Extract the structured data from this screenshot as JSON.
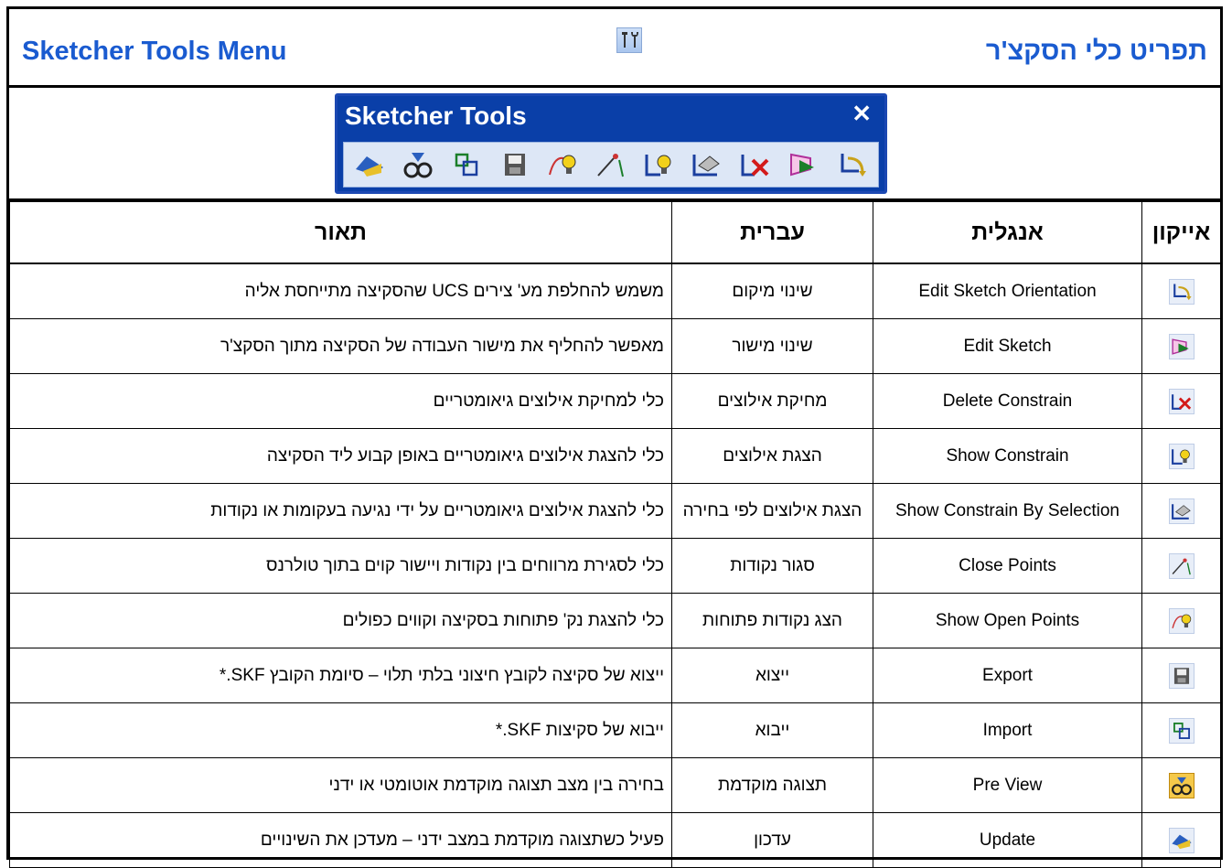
{
  "header": {
    "title_en": "Sketcher Tools Menu",
    "title_he": "תפריט כלי הסקצ'ר"
  },
  "toolbar": {
    "title": "Sketcher Tools",
    "close": "✕"
  },
  "table": {
    "columns": {
      "icon": "אייקון",
      "english": "אנגלית",
      "hebrew": "עברית",
      "description": "תאור"
    },
    "rows": [
      {
        "icon": "edit-sketch-orientation-icon",
        "english": "Edit Sketch Orientation",
        "hebrew": "שינוי מיקום",
        "description": "משמש להחלפת מע' צירים UCS שהסקיצה מתייחסת אליה"
      },
      {
        "icon": "edit-sketch-icon",
        "english": "Edit Sketch",
        "hebrew": "שינוי מישור",
        "description": "מאפשר להחליף את מישור העבודה של הסקיצה מתוך הסקצ'ר"
      },
      {
        "icon": "delete-constrain-icon",
        "english": "Delete Constrain",
        "hebrew": "מחיקת אילוצים",
        "description": "כלי למחיקת אילוצים גיאומטריים"
      },
      {
        "icon": "show-constrain-icon",
        "english": "Show Constrain",
        "hebrew": "הצגת אילוצים",
        "description": "כלי להצגת אילוצים גיאומטריים באופן קבוע ליד הסקיצה"
      },
      {
        "icon": "show-constrain-by-selection-icon",
        "english": "Show Constrain By Selection",
        "hebrew": "הצגת אילוצים לפי בחירה",
        "description": "כלי להצגת אילוצים גיאומטריים על ידי נגיעה בעקומות או נקודות"
      },
      {
        "icon": "close-points-icon",
        "english": "Close Points",
        "hebrew": "סגור נקודות",
        "description": "כלי לסגירת מרווחים בין נקודות ויישור קוים בתוך טולרנס"
      },
      {
        "icon": "show-open-points-icon",
        "english": "Show Open Points",
        "hebrew": "הצג נקודות פתוחות",
        "description": "כלי להצגת נק' פתוחות בסקיצה וקווים כפולים"
      },
      {
        "icon": "export-icon",
        "english": "Export",
        "hebrew": "ייצוא",
        "description": "ייצוא של סקיצה לקובץ חיצוני בלתי תלוי – סיומת הקובץ SKF.*"
      },
      {
        "icon": "import-icon",
        "english": "Import",
        "hebrew": "ייבוא",
        "description": "ייבוא של סקיצות SKF.*"
      },
      {
        "icon": "pre-view-icon",
        "english": "Pre View",
        "hebrew": "תצוגה מוקדמת",
        "description": "בחירה בין מצב תצוגה מוקדמת אוטומטי או ידני"
      },
      {
        "icon": "update-icon",
        "english": "Update",
        "hebrew": "עדכון",
        "description": "פעיל כשתצוגה מוקדמת במצב ידני – מעדכן את השינויים"
      }
    ]
  },
  "colors": {
    "title": "#1a5bd0",
    "toolbar_bg": "#0a3fa8",
    "preview_active": "#f5c94a"
  }
}
